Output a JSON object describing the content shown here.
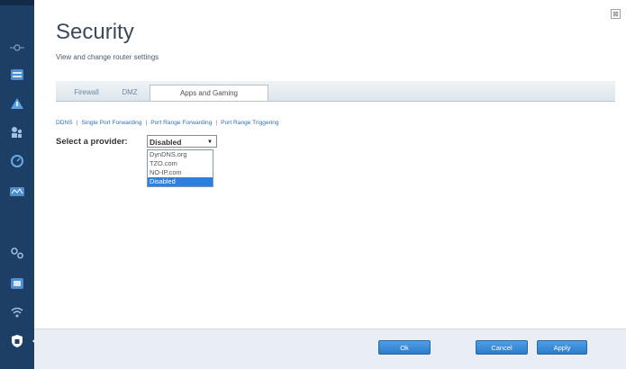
{
  "window": {
    "close_glyph": "⊠"
  },
  "page": {
    "title": "Security",
    "subtitle": "View and change router settings"
  },
  "tabs": [
    {
      "label": "Firewall"
    },
    {
      "label": "DMZ"
    },
    {
      "label": "Apps and Gaming",
      "active": true
    }
  ],
  "subnav": [
    {
      "label": "DDNS"
    },
    {
      "label": "Single Port Forwarding"
    },
    {
      "label": "Port Range Forwarding"
    },
    {
      "label": "Port Range Triggering"
    }
  ],
  "provider": {
    "label": "Select a provider:",
    "selected": "Disabled",
    "options": [
      "DynDNS.org",
      "TZO.com",
      "NO-IP.com",
      "Disabled"
    ]
  },
  "footer": {
    "ok_label": "Ok",
    "cancel_label": "Cancel",
    "apply_label": "Apply"
  },
  "sidebar": {
    "items": [
      {
        "icon": "network-map-icon"
      },
      {
        "icon": "device-list-icon"
      },
      {
        "icon": "alert-icon"
      },
      {
        "icon": "parental-controls-icon"
      },
      {
        "icon": "speed-test-icon"
      },
      {
        "icon": "media-prioritization-icon"
      },
      {
        "icon": "settings-icon"
      },
      {
        "icon": "connectivity-icon"
      },
      {
        "icon": "wireless-icon"
      },
      {
        "icon": "security-icon",
        "active": true
      }
    ]
  },
  "colors": {
    "sidebar_bg": "#1d3f66",
    "accent_blue": "#2d7fe0",
    "link_blue": "#2f6fb5"
  }
}
